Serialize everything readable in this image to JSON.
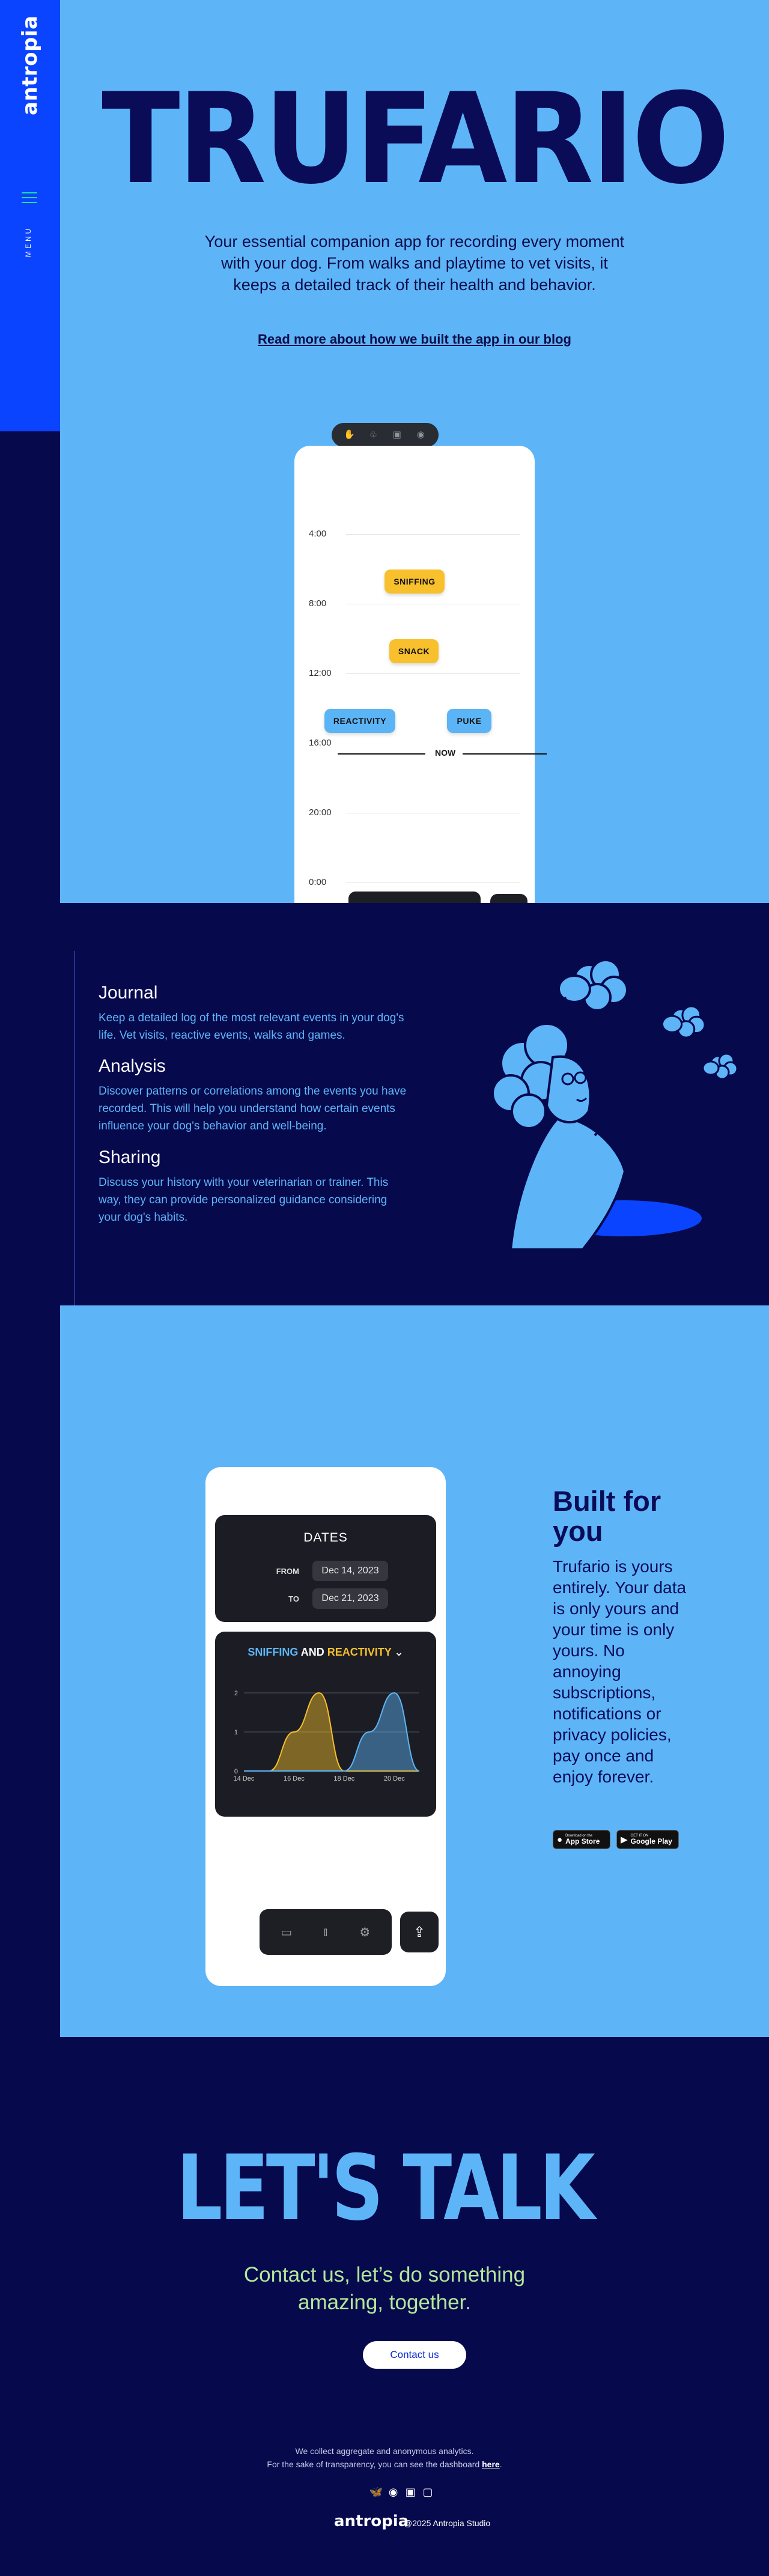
{
  "sidebar": {
    "brand": "antropia",
    "menu_label": "MENU"
  },
  "hero": {
    "title": "TRUFARIO",
    "description": "Your essential companion app for recording every moment with your dog. From walks and playtime to vet visits, it keeps a detailed track of their health and behavior.",
    "blog_link": "Read more about how we built the app in our blog"
  },
  "toolbar_icons": [
    "paw-icon",
    "leaf-icon",
    "camera-icon",
    "settings-icon"
  ],
  "timeline": {
    "times": [
      "4:00",
      "8:00",
      "12:00",
      "16:00",
      "20:00",
      "0:00"
    ],
    "events": [
      "SNIFFING",
      "SNACK",
      "REACTIVITY",
      "PUKE"
    ],
    "now_label": "NOW"
  },
  "features": [
    {
      "title": "Journal",
      "text": "Keep a detailed log of the most relevant events in your dog's life. Vet visits, reactive events, walks and games."
    },
    {
      "title": "Analysis",
      "text": "Discover patterns or correlations among the events you have recorded. This will help you understand how certain events influence your dog's behavior and well-being."
    },
    {
      "title": "Sharing",
      "text": "Discuss your history with your veterinarian or trainer. This way, they can provide personalized guidance considering your dog's habits."
    }
  ],
  "dates": {
    "title": "DATES",
    "from_label": "FROM",
    "from_value": "Dec 14, 2023",
    "to_label": "TO",
    "to_value": "Dec 21, 2023"
  },
  "chart_header": {
    "series1": "SNIFFING",
    "and": "AND",
    "series2": "REACTIVITY",
    "chevron": "⌄"
  },
  "chart_data": {
    "type": "area",
    "x": [
      "14 Dec",
      "15 Dec",
      "16 Dec",
      "17 Dec",
      "18 Dec",
      "19 Dec",
      "20 Dec",
      "21 Dec"
    ],
    "xticks": [
      "14 Dec",
      "16 Dec",
      "18 Dec",
      "20 Dec"
    ],
    "yticks": [
      "0",
      "1",
      "2"
    ],
    "ylim": [
      0,
      2
    ],
    "series": [
      {
        "name": "SNIFFING",
        "color": "#f7c02c",
        "values": [
          0,
          0,
          1,
          2,
          0,
          0,
          0,
          0
        ]
      },
      {
        "name": "REACTIVITY",
        "color": "#5db5f8",
        "values": [
          0,
          0,
          0,
          0,
          0,
          1,
          2,
          0
        ]
      }
    ]
  },
  "nav_icons": [
    "book-icon",
    "chart-icon",
    "gear-icon",
    "share-icon"
  ],
  "built": {
    "title": "Built for you",
    "description": "Trufario is yours entirely. Your data is only yours and your time is only yours. No annoying subscriptions, notifications or privacy policies, pay once and enjoy forever.",
    "app_store_small": "Download on the",
    "app_store": "App Store",
    "google_play_small": "GET IT ON",
    "google_play": "Google Play"
  },
  "contact": {
    "heading": "LET'S TALK",
    "tagline": "Contact us, let’s do something amazing, together.",
    "button": "Contact us"
  },
  "footer": {
    "analytics_line": "We collect aggregate and anonymous analytics.",
    "dashboard_line": "For the sake of transparency, you can see the dashboard",
    "dashboard_link": "here",
    "brand": "antropia",
    "copyright": "@2025 Antropia Studio",
    "social_icons": [
      "bluesky-icon",
      "github-icon",
      "linkedin-icon",
      "mastodon-icon"
    ]
  },
  "colors": {
    "navy": "#07094d",
    "sky": "#5db5f8",
    "blue": "#0a44ff",
    "yellow": "#f7c02c",
    "mint": "#b2e79a"
  }
}
